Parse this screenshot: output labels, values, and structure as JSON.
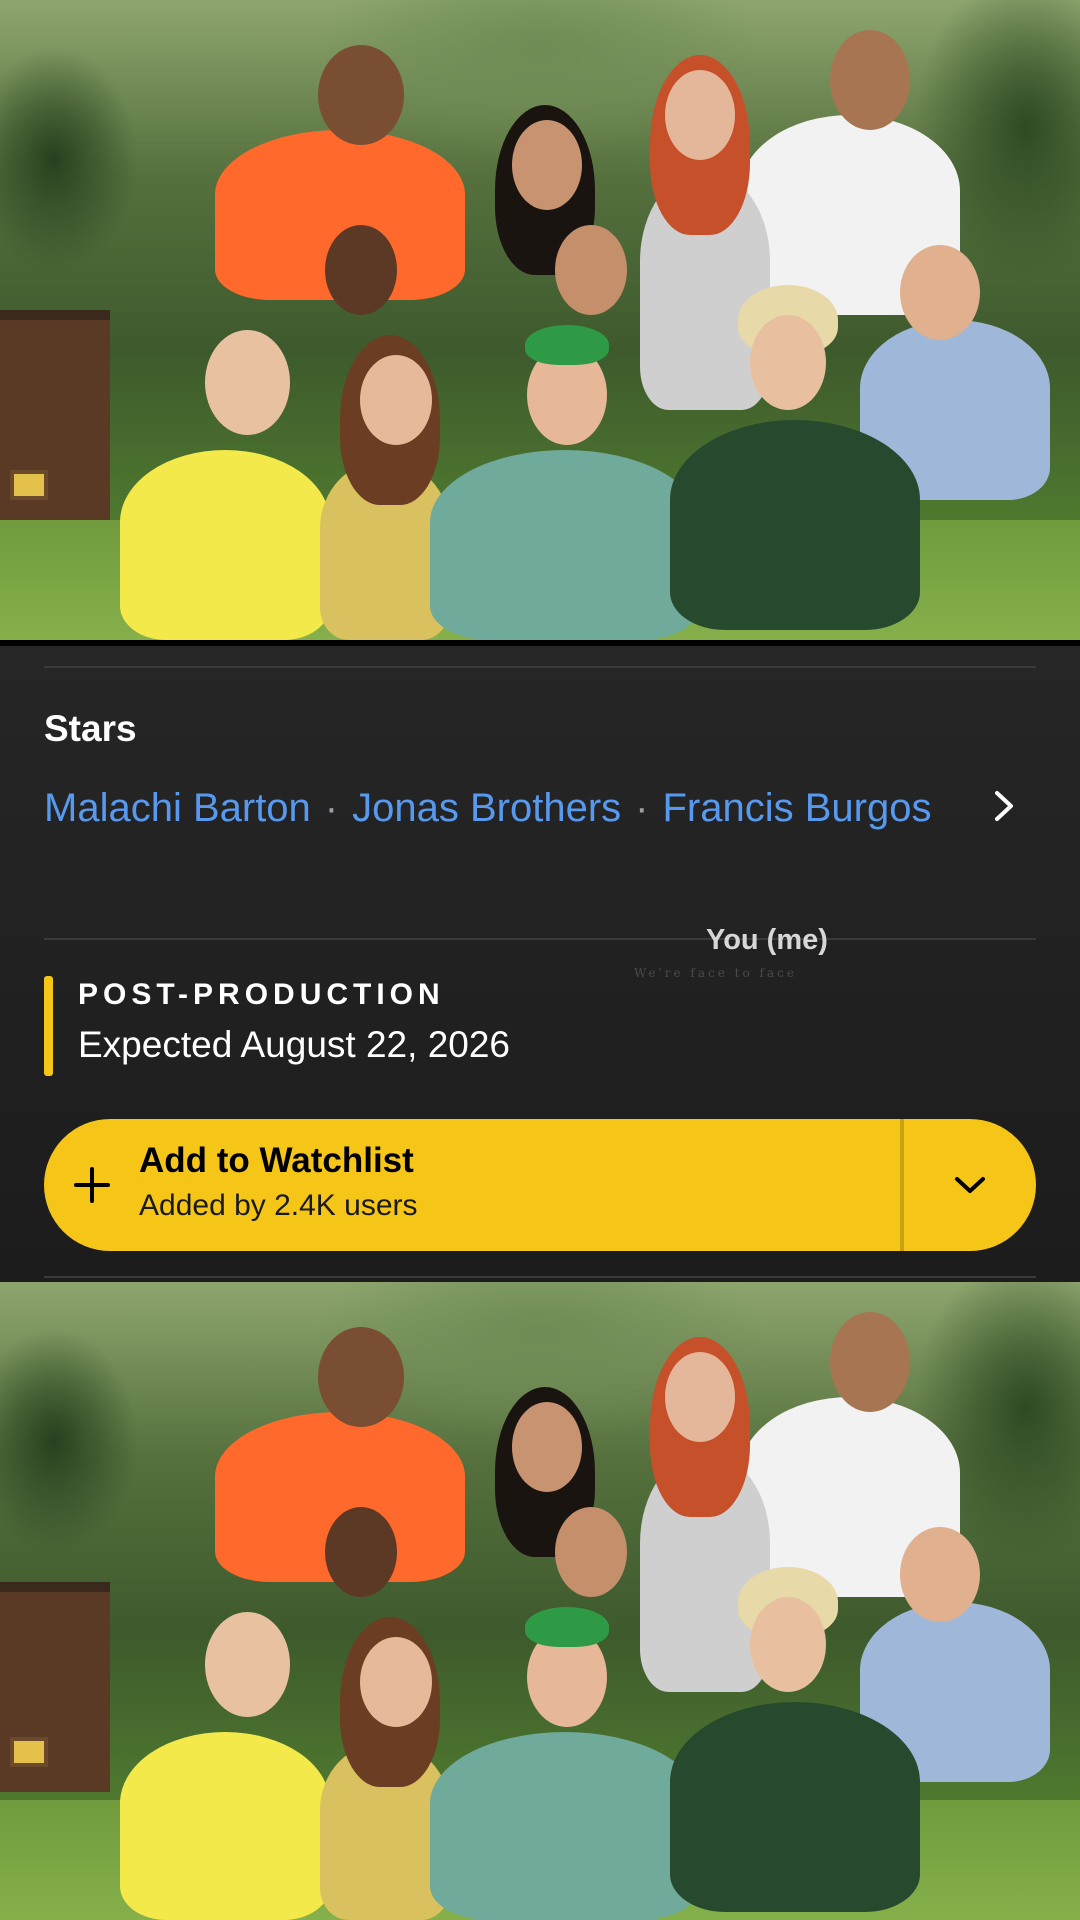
{
  "stars": {
    "heading": "Stars",
    "names": [
      "Malachi Barton",
      "Jonas Brothers",
      "Francis Burgos"
    ],
    "separator": "·"
  },
  "overlay": {
    "caption": "You (me)",
    "subcaption": "We're face to face"
  },
  "status": {
    "title": "POST-PRODUCTION",
    "expected": "Expected August 22, 2026",
    "accent_color": "#f5c518"
  },
  "watchlist": {
    "label": "Add to Watchlist",
    "sub": "Added by 2.4K users",
    "button_color": "#f5c518",
    "icons": [
      "plus-icon",
      "chevron-down-icon"
    ]
  },
  "colors": {
    "link": "#5799ef",
    "background": "#1f1f1f"
  }
}
